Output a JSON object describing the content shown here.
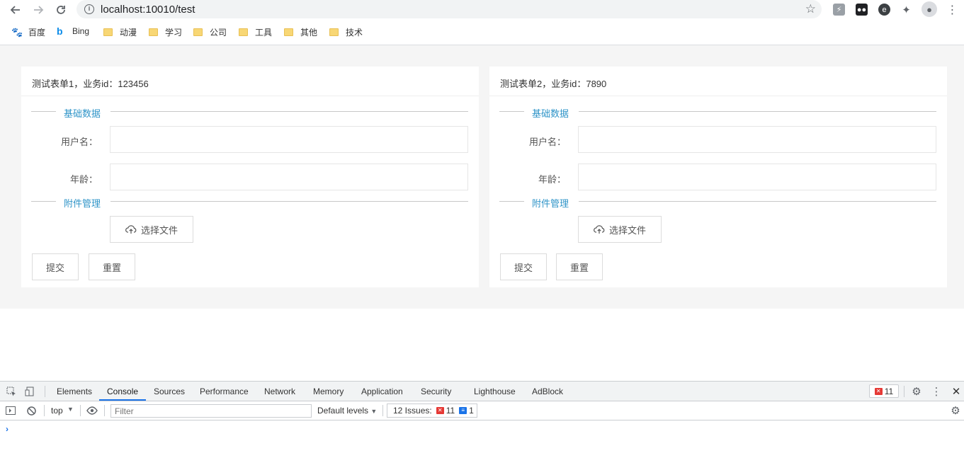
{
  "browser": {
    "url": "localhost:10010/test",
    "bookmarks": [
      {
        "label": "百度",
        "icon": "baidu-icon"
      },
      {
        "label": "Bing",
        "icon": "bing-icon"
      },
      {
        "label": "动漫",
        "icon": "folder-icon"
      },
      {
        "label": "学习",
        "icon": "folder-icon"
      },
      {
        "label": "公司",
        "icon": "folder-icon"
      },
      {
        "label": "工具",
        "icon": "folder-icon"
      },
      {
        "label": "其他",
        "icon": "folder-icon"
      },
      {
        "label": "技术",
        "icon": "folder-icon"
      }
    ]
  },
  "forms": [
    {
      "title": "测试表单1，业务id：123456",
      "section_basic": "基础数据",
      "username_label": "用户名：",
      "username_value": "",
      "age_label": "年龄：",
      "age_value": "",
      "section_attach": "附件管理",
      "upload_label": "选择文件",
      "submit_label": "提交",
      "reset_label": "重置"
    },
    {
      "title": "测试表单2，业务id：7890",
      "section_basic": "基础数据",
      "username_label": "用户名：",
      "username_value": "",
      "age_label": "年龄：",
      "age_value": "",
      "section_attach": "附件管理",
      "upload_label": "选择文件",
      "submit_label": "提交",
      "reset_label": "重置"
    }
  ],
  "devtools": {
    "tabs": [
      "Elements",
      "Console",
      "Sources",
      "Performance",
      "Network",
      "Memory",
      "Application",
      "Security",
      "Lighthouse",
      "AdBlock"
    ],
    "active_tab": "Console",
    "error_count": "11",
    "context": "top",
    "filter_placeholder": "Filter",
    "levels": "Default levels",
    "issues_label": "12 Issues:",
    "issues_errors": "11",
    "issues_messages": "1",
    "prompt": "›"
  }
}
